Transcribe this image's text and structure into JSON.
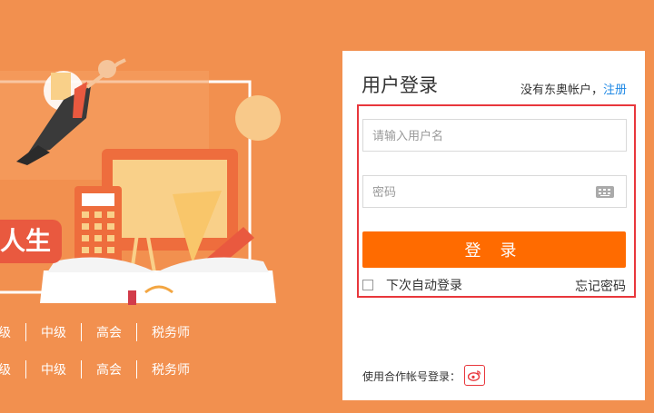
{
  "hero": {
    "slogan": "人生",
    "course_rows": [
      [
        "级",
        "中级",
        "高会",
        "税务师"
      ],
      [
        "级",
        "中级",
        "高会",
        "税务师"
      ]
    ]
  },
  "login": {
    "title": "用户登录",
    "no_account_text": "没有东奥帐户，",
    "register_link": "注册",
    "username_placeholder": "请输入用户名",
    "password_placeholder": "密码",
    "login_button": "登 录",
    "remember_label": "下次自动登录",
    "forgot_link": "忘记密码",
    "third_party_label": "使用合作帐号登录：",
    "weibo_icon": "weibo-icon"
  },
  "colors": {
    "page_bg": "#f2904f",
    "accent": "#ff6b00",
    "highlight_border": "#e8373c",
    "link": "#1e88e5"
  }
}
